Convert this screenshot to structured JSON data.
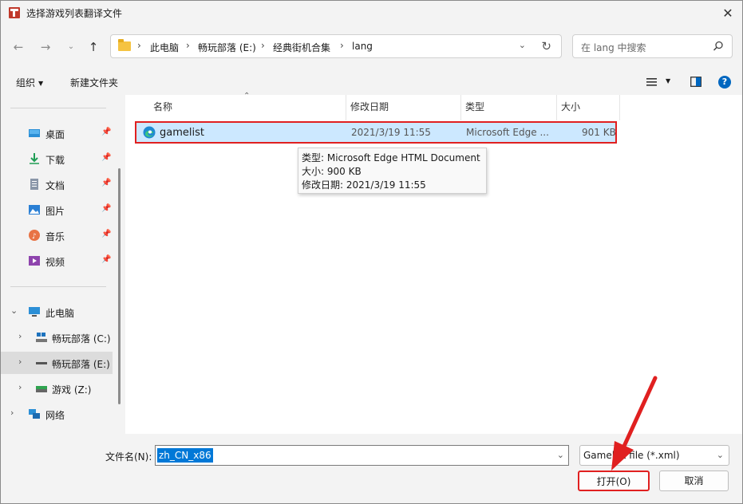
{
  "window": {
    "title": "选择游戏列表翻译文件",
    "close_label": "✕"
  },
  "nav": {
    "breadcrumb": [
      "此电脑",
      "畅玩部落 (E:)",
      "经典街机合集",
      "lang"
    ],
    "search_placeholder": "在 lang 中搜索"
  },
  "toolbar": {
    "organize_label": "组织",
    "new_folder_label": "新建文件夹"
  },
  "sidebar": {
    "quick_access": [
      {
        "label": "桌面",
        "icon": "desktop-icon"
      },
      {
        "label": "下载",
        "icon": "download-icon"
      },
      {
        "label": "文档",
        "icon": "document-icon"
      },
      {
        "label": "图片",
        "icon": "pictures-icon"
      },
      {
        "label": "音乐",
        "icon": "music-icon"
      },
      {
        "label": "视频",
        "icon": "video-icon"
      }
    ],
    "this_pc": "此电脑",
    "drives": [
      {
        "label": "畅玩部落 (C:)",
        "icon": "drive-c-icon"
      },
      {
        "label": "畅玩部落 (E:)",
        "icon": "drive-e-icon",
        "selected": true
      },
      {
        "label": "游戏 (Z:)",
        "icon": "drive-z-icon"
      }
    ],
    "network": "网络"
  },
  "file_list": {
    "columns": [
      "名称",
      "修改日期",
      "类型",
      "大小"
    ],
    "rows": [
      {
        "name": "gamelist",
        "modified": "2021/3/19 11:55",
        "type": "Microsoft Edge ...",
        "size": "901 KB",
        "icon": "edge-html-icon"
      }
    ]
  },
  "tooltip": {
    "type": "类型: Microsoft Edge HTML Document",
    "size": "大小: 900 KB",
    "modified": "修改日期: 2021/3/19 11:55"
  },
  "bottom": {
    "filename_label": "文件名(N):",
    "filename_value": "zh_CN_x86",
    "filetype_value": "Gamelist file (*.xml)",
    "open_label": "打开(O)",
    "cancel_label": "取消"
  },
  "colors": {
    "accent": "#0078d7",
    "highlight_red": "#e02020",
    "selection": "#cce8ff"
  }
}
